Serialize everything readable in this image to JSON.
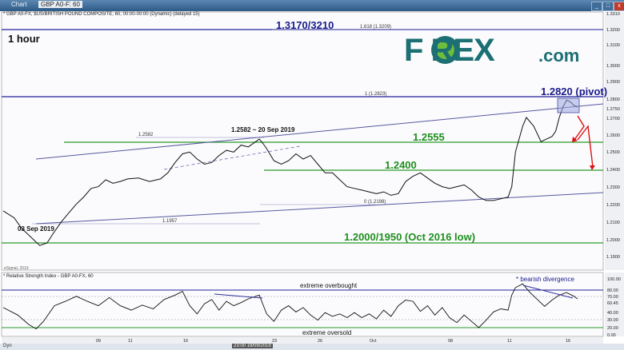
{
  "window": {
    "tab_label": "Chart",
    "symbol_field": "GBP A0-FX",
    "interval_field": "60",
    "minimize": "_",
    "maximize": "□",
    "close": "x"
  },
  "chart_info": "* GBP A0-FX, $US/BRITISH POUND COMPOSITE, 60, 00:00-00:00 (Dynamic) (delayed 15)",
  "timeframe_label": "1 hour",
  "logo": {
    "text": "F  REX",
    "suffix": ".com"
  },
  "watermark": "eSignal, 2019",
  "rsi_info": "* Relative Strength Index - GBP A0-FX, 60",
  "status_dyn": "Dyn",
  "status_date": "23:00 19/09/2019",
  "colors": {
    "price": "#111111",
    "support": "#2a9a2a",
    "resistance": "#20209a",
    "channel": "#5858a0",
    "arrow": "#dd1111",
    "text_green": "#1f8f1f",
    "text_blue": "#1a1a8c"
  },
  "chart_data": {
    "type": "line",
    "title": "1 hour",
    "y_axis_labels": [
      "1.3310",
      "1.3200",
      "1.3100",
      "1.3000",
      "1.2900",
      "1.2800",
      "1.2750",
      "1.2700",
      "1.2600",
      "1.2500",
      "1.2400",
      "1.2300",
      "1.2200",
      "1.2100",
      "1.2000",
      "1.1900"
    ],
    "x_axis_labels": [
      "09",
      "11",
      "16",
      "23",
      "26",
      "Oct",
      "08",
      "11",
      "16"
    ],
    "ylim": [
      1.185,
      1.331
    ],
    "price_series": [
      [
        0,
        1.216
      ],
      [
        3,
        1.212
      ],
      [
        5,
        1.206
      ],
      [
        8,
        1.2
      ],
      [
        10,
        1.196
      ],
      [
        12,
        1.1975
      ],
      [
        14,
        1.204
      ],
      [
        16,
        1.21
      ],
      [
        18,
        1.215
      ],
      [
        20,
        1.22
      ],
      [
        22,
        1.224
      ],
      [
        24,
        1.229
      ],
      [
        26,
        1.23
      ],
      [
        28,
        1.234
      ],
      [
        30,
        1.232
      ],
      [
        32,
        1.233
      ],
      [
        34,
        1.2345
      ],
      [
        37,
        1.235
      ],
      [
        40,
        1.233
      ],
      [
        43,
        1.2345
      ],
      [
        45,
        1.238
      ],
      [
        47,
        1.244
      ],
      [
        49,
        1.249
      ],
      [
        51,
        1.25
      ],
      [
        53,
        1.246
      ],
      [
        55,
        1.243
      ],
      [
        57,
        1.244
      ],
      [
        59,
        1.248
      ],
      [
        61,
        1.251
      ],
      [
        63,
        1.25
      ],
      [
        65,
        1.254
      ],
      [
        67,
        1.253
      ],
      [
        69,
        1.256
      ],
      [
        70,
        1.2575
      ],
      [
        71,
        1.255
      ],
      [
        72,
        1.252
      ],
      [
        74,
        1.245
      ],
      [
        76,
        1.243
      ],
      [
        78,
        1.245
      ],
      [
        80,
        1.249
      ],
      [
        82,
        1.246
      ],
      [
        84,
        1.248
      ],
      [
        86,
        1.243
      ],
      [
        88,
        1.238
      ],
      [
        90,
        1.238
      ],
      [
        92,
        1.234
      ],
      [
        94,
        1.23
      ],
      [
        96,
        1.229
      ],
      [
        98,
        1.228
      ],
      [
        100,
        1.227
      ],
      [
        102,
        1.226
      ],
      [
        104,
        1.227
      ],
      [
        106,
        1.225
      ],
      [
        108,
        1.226
      ],
      [
        110,
        1.233
      ],
      [
        112,
        1.236
      ],
      [
        114,
        1.238
      ],
      [
        116,
        1.235
      ],
      [
        118,
        1.232
      ],
      [
        120,
        1.23
      ],
      [
        122,
        1.229
      ],
      [
        124,
        1.23
      ],
      [
        126,
        1.231
      ],
      [
        128,
        1.228
      ],
      [
        130,
        1.224
      ],
      [
        132,
        1.222
      ],
      [
        134,
        1.222
      ],
      [
        136,
        1.223
      ],
      [
        138,
        1.224
      ],
      [
        139,
        1.23
      ],
      [
        140,
        1.25
      ],
      [
        142,
        1.265
      ],
      [
        143,
        1.27
      ],
      [
        145,
        1.265
      ],
      [
        147,
        1.256
      ],
      [
        148,
        1.257
      ],
      [
        150,
        1.259
      ],
      [
        151,
        1.262
      ],
      [
        152,
        1.27
      ],
      [
        153,
        1.276
      ],
      [
        154,
        1.28
      ],
      [
        155,
        1.279
      ],
      [
        156,
        1.277
      ],
      [
        157,
        1.276
      ]
    ],
    "rsi_series": [
      [
        0,
        52
      ],
      [
        4,
        40
      ],
      [
        7,
        25
      ],
      [
        9,
        18
      ],
      [
        11,
        30
      ],
      [
        14,
        55
      ],
      [
        17,
        62
      ],
      [
        20,
        70
      ],
      [
        23,
        62
      ],
      [
        26,
        55
      ],
      [
        29,
        68
      ],
      [
        32,
        55
      ],
      [
        35,
        48
      ],
      [
        38,
        56
      ],
      [
        41,
        50
      ],
      [
        44,
        65
      ],
      [
        47,
        72
      ],
      [
        49,
        78
      ],
      [
        51,
        55
      ],
      [
        53,
        42
      ],
      [
        55,
        58
      ],
      [
        57,
        65
      ],
      [
        59,
        48
      ],
      [
        61,
        62
      ],
      [
        63,
        55
      ],
      [
        65,
        60
      ],
      [
        67,
        66
      ],
      [
        69,
        70
      ],
      [
        70,
        72
      ],
      [
        72,
        42
      ],
      [
        74,
        30
      ],
      [
        76,
        48
      ],
      [
        78,
        55
      ],
      [
        80,
        45
      ],
      [
        82,
        52
      ],
      [
        84,
        40
      ],
      [
        86,
        32
      ],
      [
        88,
        44
      ],
      [
        90,
        38
      ],
      [
        92,
        42
      ],
      [
        94,
        36
      ],
      [
        96,
        44
      ],
      [
        98,
        36
      ],
      [
        100,
        42
      ],
      [
        102,
        34
      ],
      [
        104,
        48
      ],
      [
        106,
        38
      ],
      [
        108,
        55
      ],
      [
        110,
        64
      ],
      [
        112,
        62
      ],
      [
        114,
        46
      ],
      [
        116,
        55
      ],
      [
        118,
        40
      ],
      [
        120,
        52
      ],
      [
        122,
        36
      ],
      [
        124,
        28
      ],
      [
        126,
        40
      ],
      [
        128,
        30
      ],
      [
        130,
        20
      ],
      [
        132,
        32
      ],
      [
        134,
        45
      ],
      [
        136,
        50
      ],
      [
        138,
        48
      ],
      [
        139,
        72
      ],
      [
        140,
        84
      ],
      [
        142,
        90
      ],
      [
        144,
        76
      ],
      [
        146,
        65
      ],
      [
        148,
        54
      ],
      [
        150,
        64
      ],
      [
        152,
        72
      ],
      [
        154,
        76
      ],
      [
        156,
        70
      ],
      [
        157,
        66
      ]
    ],
    "rsi_ticks": [
      "100.00",
      "80.00",
      "70.00",
      "60.45",
      "40.00",
      "30.00",
      "20.00",
      "0.00"
    ],
    "levels": [
      {
        "label": "1.3170/3210",
        "value": 1.3195,
        "kind": "resistance"
      },
      {
        "label": "1.2820 (pivot)",
        "value": 1.282,
        "kind": "resistance"
      },
      {
        "label": "1.2555",
        "value": 1.2555,
        "kind": "support"
      },
      {
        "label": "1.2400",
        "value": 1.24,
        "kind": "support"
      },
      {
        "label": "1.2000/1950 (Oct 2016 low)",
        "value": 1.1975,
        "kind": "support"
      }
    ],
    "fib_labels": [
      "1.618 (1.3209)",
      "1 (1.2823)",
      "1.2582",
      "0 (1.2198)",
      "1.1957"
    ],
    "annotations": [
      "1.2582 ~ 20 Sep 2019",
      "03 Sep 2019"
    ],
    "rsi_annotations": [
      "extreme overbought",
      "extreme oversold",
      "* bearish divergence"
    ]
  }
}
